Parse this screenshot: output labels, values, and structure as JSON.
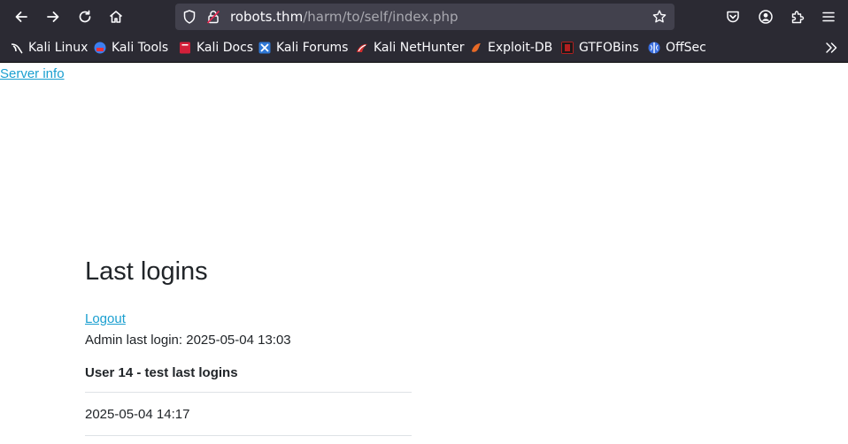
{
  "browser": {
    "url_host": "robots.thm",
    "url_path": "/harm/to/self/index.php"
  },
  "bookmarks": [
    {
      "label": "Kali Linux",
      "icon": "kali-dragon-icon",
      "color": "#ffffff"
    },
    {
      "label": "Kali Tools",
      "icon": "kali-tools-icon",
      "color": "#3d7ff0"
    },
    {
      "label": "Kali Docs",
      "icon": "kali-docs-icon",
      "color": "#d3203a"
    },
    {
      "label": "Kali Forums",
      "icon": "kali-forums-icon",
      "color": "#2f78d6"
    },
    {
      "label": "Kali NetHunter",
      "icon": "nethunter-icon",
      "color": "#d12d2d"
    },
    {
      "label": "Exploit-DB",
      "icon": "exploit-db-icon",
      "color": "#e86a26"
    },
    {
      "label": "GTFOBins",
      "icon": "gtfobins-icon",
      "color": "#b21f1f"
    },
    {
      "label": "OffSec",
      "icon": "offsec-icon",
      "color": "#3a6fe0"
    }
  ],
  "page": {
    "server_info_link": "Server info",
    "title": "Last logins",
    "logout_link": "Logout",
    "admin_last_login": "Admin last login: 2025-05-04 13:03",
    "table_header": "User 14 - test last logins",
    "rows": [
      "2025-05-04 14:17"
    ]
  },
  "colors": {
    "chrome_bg": "#2b2a33",
    "urlbar_bg": "#42414d",
    "link": "#1a9fd0",
    "text": "#212529"
  }
}
